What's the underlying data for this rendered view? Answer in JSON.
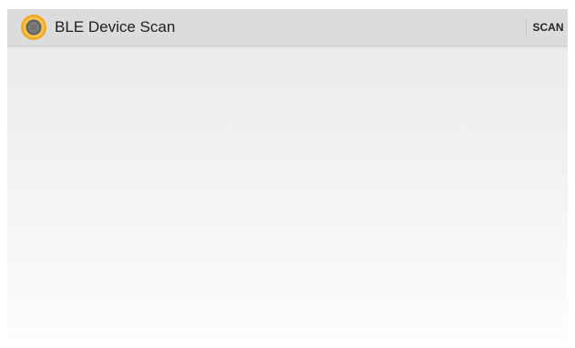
{
  "action_bar": {
    "title": "BLE Device Scan",
    "scan_label": "SCAN",
    "app_icon": "ble-app-icon"
  },
  "device_list": {
    "items": []
  },
  "colors": {
    "action_bar_bg": "#dcdcdc",
    "icon_accent": "#f2a81d",
    "icon_center": "#666666"
  }
}
